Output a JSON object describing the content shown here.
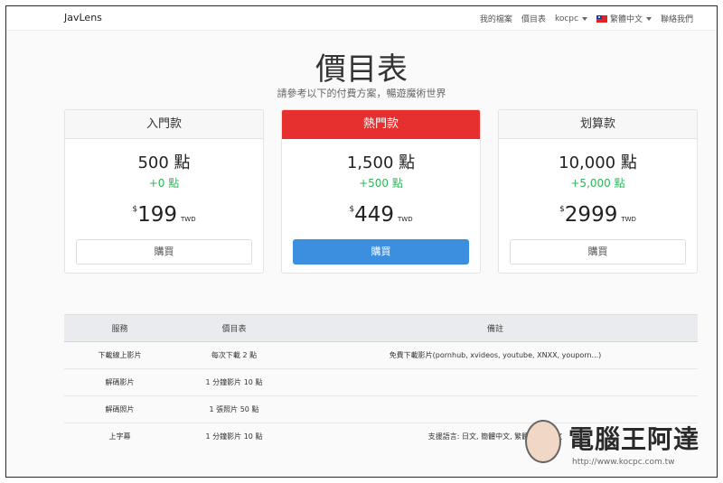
{
  "navbar": {
    "brand": "JavLens",
    "links": {
      "my_files": "我的檔案",
      "pricing": "價目表",
      "user": "kocpc",
      "language": "繁體中文",
      "contact": "聯絡我們"
    }
  },
  "page": {
    "title": "價目表",
    "subtitle": "請參考以下的付費方案，暢遊魔術世界"
  },
  "plans": [
    {
      "name": "入門款",
      "points": "500 點",
      "bonus": "+0 點",
      "currency": "$",
      "price": "199",
      "unit": "TWD",
      "button": "購買"
    },
    {
      "name": "熱門款",
      "points": "1,500 點",
      "bonus": "+500 點",
      "currency": "$",
      "price": "449",
      "unit": "TWD",
      "button": "購買"
    },
    {
      "name": "划算款",
      "points": "10,000 點",
      "bonus": "+5,000 點",
      "currency": "$",
      "price": "2999",
      "unit": "TWD",
      "button": "購買"
    }
  ],
  "table": {
    "headers": [
      "服務",
      "價目表",
      "備註"
    ],
    "rows": [
      [
        "下載線上影片",
        "每次下載 2 點",
        "免費下載影片(pornhub, xvideos, youtube, XNXX, youporn...)"
      ],
      [
        "解碼影片",
        "1 分鐘影片 10 點",
        ""
      ],
      [
        "解碼照片",
        "1 張照片 50 點",
        ""
      ],
      [
        "上字幕",
        "1 分鐘影片 10 點",
        "支援語言: 日文, 簡體中文, 繁體中文, 韓文"
      ]
    ]
  },
  "watermark": {
    "title": "電腦王阿達",
    "url": "http://www.kocpc.com.tw"
  },
  "colors": {
    "featured_header": "#e5302f",
    "featured_button": "#3c8fde",
    "bonus_text": "#2fb55a"
  }
}
